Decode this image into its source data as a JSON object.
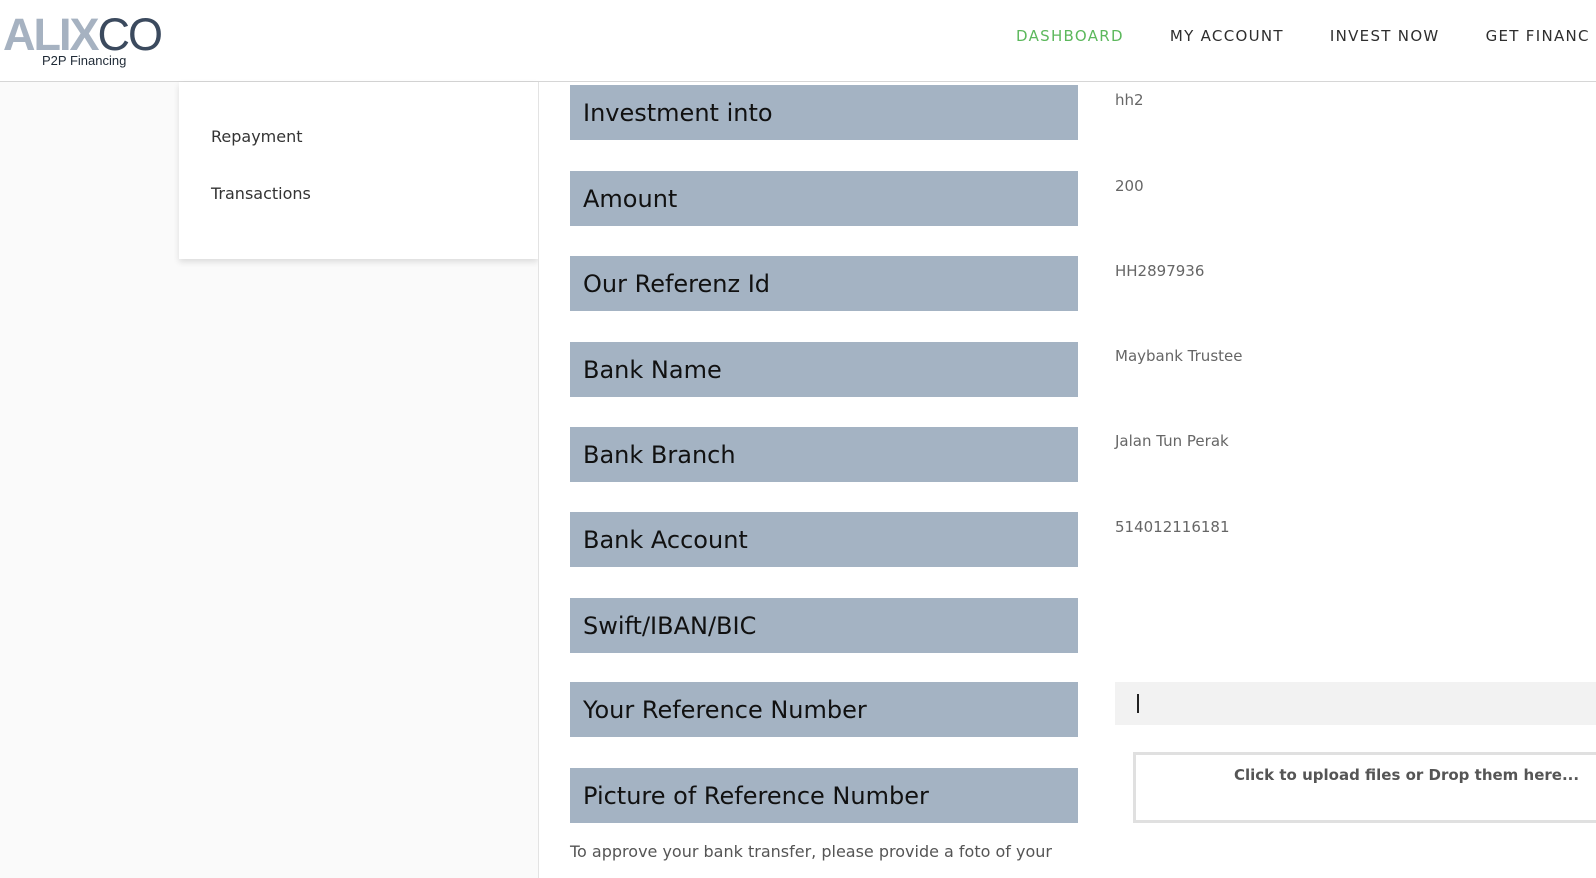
{
  "header": {
    "logo": {
      "part1": "ALI",
      "part2": "X",
      "part3": "CO",
      "subtitle": "P2P Financing"
    },
    "nav": [
      {
        "label": "DASHBOARD",
        "active": true
      },
      {
        "label": "MY ACCOUNT",
        "active": false
      },
      {
        "label": "INVEST NOW",
        "active": false
      },
      {
        "label": "GET FINANC",
        "active": false
      }
    ]
  },
  "sidebar": {
    "items": [
      {
        "label": "Repayment"
      },
      {
        "label": "Transactions"
      }
    ]
  },
  "form": {
    "fields": [
      {
        "label": "Investment into",
        "value": "hh2"
      },
      {
        "label": "Amount",
        "value": "200"
      },
      {
        "label": "Our Referenz Id",
        "value": "HH2897936"
      },
      {
        "label": "Bank Name",
        "value": "Maybank Trustee"
      },
      {
        "label": "Bank Branch",
        "value": "Jalan Tun Perak"
      },
      {
        "label": "Bank Account",
        "value": "514012116181"
      },
      {
        "label": "Swift/IBAN/BIC",
        "value": ""
      },
      {
        "label": "Your Reference Number",
        "value": ""
      },
      {
        "label": "Picture of Reference Number",
        "value": ""
      }
    ],
    "reference_input_value": "",
    "dropzone_text": "Click to upload files or Drop them here...",
    "help_text": "To approve your bank transfer, please provide a foto of your"
  },
  "colors": {
    "accent_active_nav": "#5cb85c",
    "label_background": "#a4b3c3",
    "logo_light": "#a6b2c1",
    "logo_dark": "#3b4a5e"
  }
}
